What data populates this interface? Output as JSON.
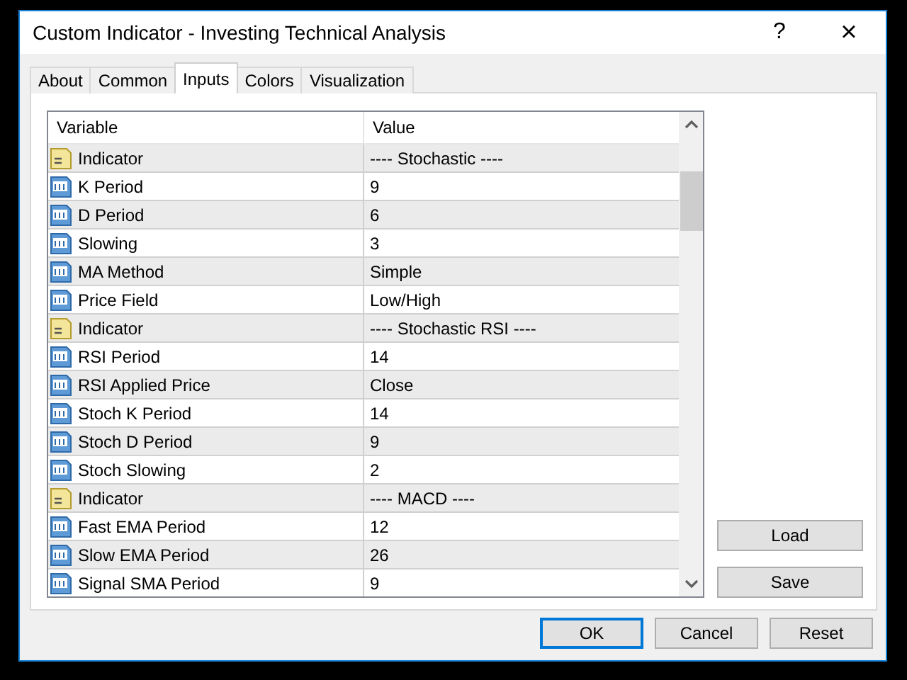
{
  "window": {
    "title": "Custom Indicator - Investing Technical Analysis",
    "help": "?",
    "close": "×"
  },
  "tabs": [
    {
      "label": "About",
      "selected": false
    },
    {
      "label": "Common",
      "selected": false
    },
    {
      "label": "Inputs",
      "selected": true
    },
    {
      "label": "Colors",
      "selected": false
    },
    {
      "label": "Visualization",
      "selected": false
    }
  ],
  "table": {
    "columns": [
      "Variable",
      "Value"
    ],
    "rows": [
      {
        "kind": "text",
        "variable": "Indicator",
        "value": "---- Stochastic ----"
      },
      {
        "kind": "number",
        "variable": "K Period",
        "value": "9"
      },
      {
        "kind": "number",
        "variable": "D Period",
        "value": "6"
      },
      {
        "kind": "number",
        "variable": "Slowing",
        "value": "3"
      },
      {
        "kind": "number",
        "variable": "MA Method",
        "value": "Simple"
      },
      {
        "kind": "number",
        "variable": "Price Field",
        "value": "Low/High"
      },
      {
        "kind": "text",
        "variable": "Indicator",
        "value": "---- Stochastic RSI ----"
      },
      {
        "kind": "number",
        "variable": "RSI Period",
        "value": "14"
      },
      {
        "kind": "number",
        "variable": "RSI Applied Price",
        "value": "Close"
      },
      {
        "kind": "number",
        "variable": "Stoch K Period",
        "value": "14"
      },
      {
        "kind": "number",
        "variable": "Stoch D Period",
        "value": "9"
      },
      {
        "kind": "number",
        "variable": "Stoch Slowing",
        "value": "2"
      },
      {
        "kind": "text",
        "variable": "Indicator",
        "value": "---- MACD ----"
      },
      {
        "kind": "number",
        "variable": "Fast EMA Period",
        "value": "12"
      },
      {
        "kind": "number",
        "variable": "Slow EMA Period",
        "value": "26"
      },
      {
        "kind": "number",
        "variable": "Signal SMA Period",
        "value": "9"
      }
    ]
  },
  "side_buttons": [
    "Load",
    "Save"
  ],
  "buttons": [
    {
      "label": "OK",
      "default": true
    },
    {
      "label": "Cancel",
      "default": false
    },
    {
      "label": "Reset",
      "default": false
    }
  ]
}
